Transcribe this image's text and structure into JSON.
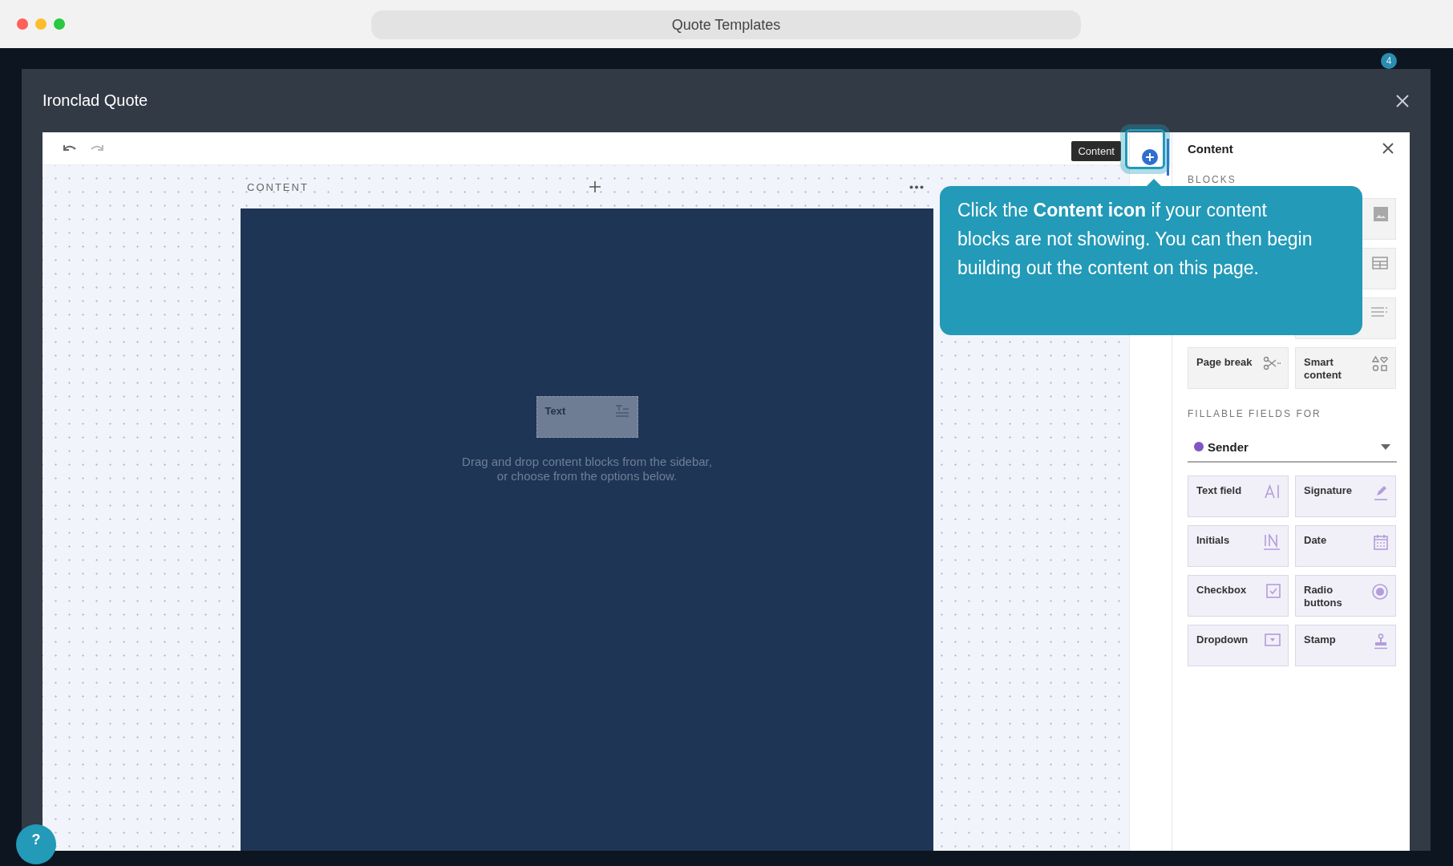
{
  "window": {
    "title": "Quote Templates"
  },
  "notification_badge": "4",
  "modal": {
    "title": "Ironclad Quote"
  },
  "canvas": {
    "section_label": "CONTENT",
    "placeholder_block": {
      "label": "Text"
    },
    "hint_lines": [
      "Drag and drop content blocks from the sidebar,",
      "or choose from the options below."
    ]
  },
  "tooltip": "Content",
  "callout": "Click the **Content icon** if your content blocks are not showing. You can then begin building out the content on this page.",
  "panel": {
    "title": "Content",
    "blocks_heading": "BLOCKS",
    "blocks": [
      {
        "label": "Page break"
      },
      {
        "label": "Smart content"
      }
    ],
    "fields_heading": "FILLABLE FIELDS FOR",
    "recipient": {
      "name": "Sender",
      "color": "#7e57c2"
    },
    "fields": [
      {
        "label": "Text field"
      },
      {
        "label": "Signature"
      },
      {
        "label": "Initials"
      },
      {
        "label": "Date"
      },
      {
        "label": "Checkbox"
      },
      {
        "label": "Radio buttons"
      },
      {
        "label": "Dropdown"
      },
      {
        "label": "Stamp"
      }
    ]
  },
  "help_button": "?"
}
